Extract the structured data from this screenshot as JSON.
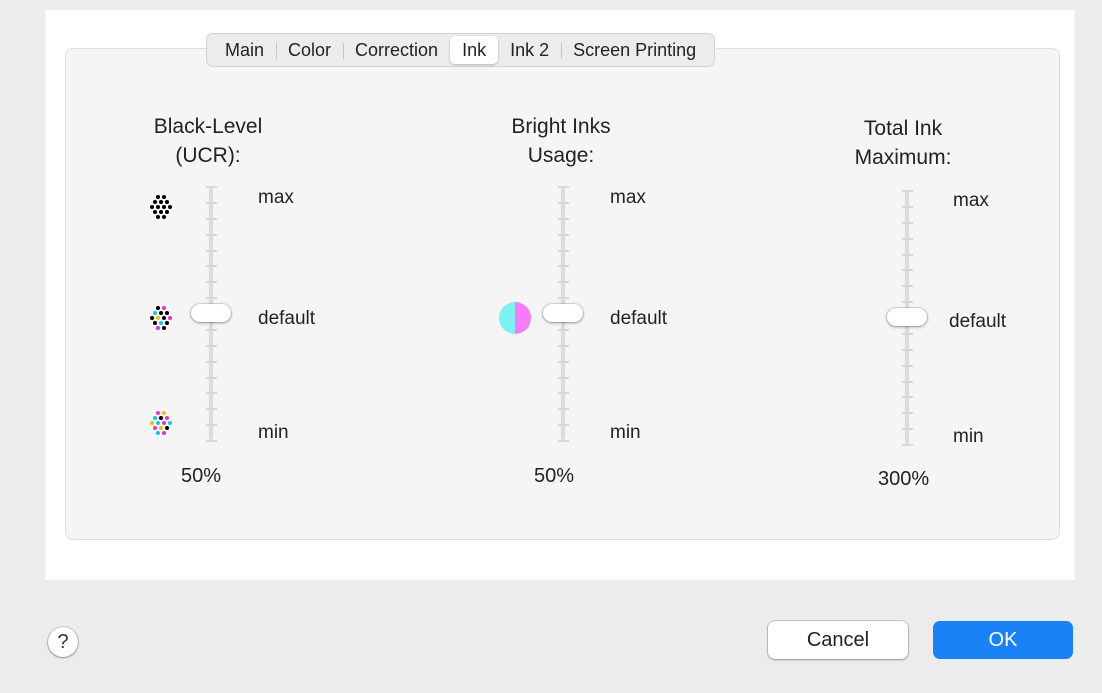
{
  "tabs": [
    {
      "label": "Main"
    },
    {
      "label": "Color"
    },
    {
      "label": "Correction"
    },
    {
      "label": "Ink",
      "selected": true
    },
    {
      "label": "Ink 2"
    },
    {
      "label": "Screen Printing"
    }
  ],
  "columns": [
    {
      "title_line1": "Black-Level",
      "title_line2": "(UCR):",
      "max_label": "max",
      "default_label": "default",
      "min_label": "min",
      "value": "50%",
      "level": "default"
    },
    {
      "title_line1": "Bright Inks",
      "title_line2": "Usage:",
      "max_label": "max",
      "default_label": "default",
      "min_label": "min",
      "value": "50%",
      "level": "default"
    },
    {
      "title_line1": "Total Ink",
      "title_line2": "Maximum:",
      "max_label": "max",
      "default_label": "default",
      "min_label": "min",
      "value": "300%",
      "level": "default"
    }
  ],
  "icons": {
    "black_max": "black-dot-pattern-icon",
    "black_default": "mixed-dot-pattern-icon",
    "black_min": "color-dot-pattern-icon",
    "bright": "cyan-magenta-split-circle-icon",
    "help": "question-mark-icon"
  },
  "help_label": "?",
  "buttons": {
    "cancel": "Cancel",
    "ok": "OK"
  },
  "colors": {
    "accent": "#1a82f7",
    "cyan": "#7ff1f2",
    "magenta": "#f47cf7"
  }
}
